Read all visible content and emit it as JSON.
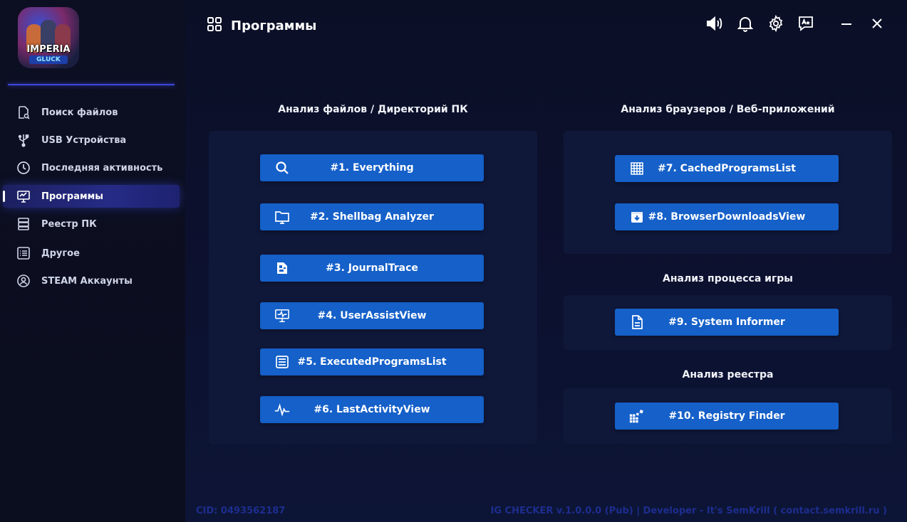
{
  "logo": {
    "line1": "IMPERIA",
    "line2": "GLUCK"
  },
  "sidebar": {
    "items": [
      {
        "label": "Поиск файлов",
        "icon": "file-search-icon"
      },
      {
        "label": "USB Устройства",
        "icon": "usb-icon"
      },
      {
        "label": "Последняя активность",
        "icon": "clock-icon"
      },
      {
        "label": "Программы",
        "icon": "monitor-icon",
        "active": true
      },
      {
        "label": "Реестр ПК",
        "icon": "registry-icon"
      },
      {
        "label": "Другое",
        "icon": "list-icon"
      },
      {
        "label": "STEAM Аккаунты",
        "icon": "user-circle-icon"
      }
    ]
  },
  "header": {
    "title": "Программы",
    "icons": [
      "volume-icon",
      "bell-icon",
      "gear-icon",
      "translate-icon",
      "minimize-icon",
      "close-icon"
    ]
  },
  "sections": {
    "files": {
      "title": "Анализ файлов / Директорий ПК",
      "buttons": [
        {
          "label": "#1. Everything",
          "icon": "search-icon"
        },
        {
          "label": "#2. Shellbag Analyzer",
          "icon": "folder-icon"
        },
        {
          "label": "#3. JournalTrace",
          "icon": "journal-icon"
        },
        {
          "label": "#4. UserAssistView",
          "icon": "monitor-pulse-icon"
        },
        {
          "label": "#5. ExecutedProgramsList",
          "icon": "list-box-icon"
        },
        {
          "label": "#6. LastActivityView",
          "icon": "pulse-icon"
        }
      ]
    },
    "browsers": {
      "title": "Анализ браузеров / Веб-приложений",
      "buttons": [
        {
          "label": "#7. CachedProgramsList",
          "icon": "grid-icon"
        },
        {
          "label": "#8. BrowserDownloadsView",
          "icon": "download-box-icon"
        }
      ]
    },
    "game": {
      "title": "Анализ процесса игры",
      "buttons": [
        {
          "label": "#9. System Informer",
          "icon": "document-icon"
        }
      ]
    },
    "registry": {
      "title": "Анализ реестра",
      "buttons": [
        {
          "label": "#10. Registry Finder",
          "icon": "registry-blocks-icon"
        }
      ]
    }
  },
  "footer": {
    "cid": "CID: 0493562187",
    "credits": "IG CHECKER v.1.0.0.0 (Pub) | Developer - It's SemKrill ( contact.semkrill.ru )"
  },
  "colors": {
    "accent": "#1560c9",
    "sidebar_active": "#262b86",
    "divider": "#3d46d8",
    "footer_text": "#1d2d8f"
  }
}
